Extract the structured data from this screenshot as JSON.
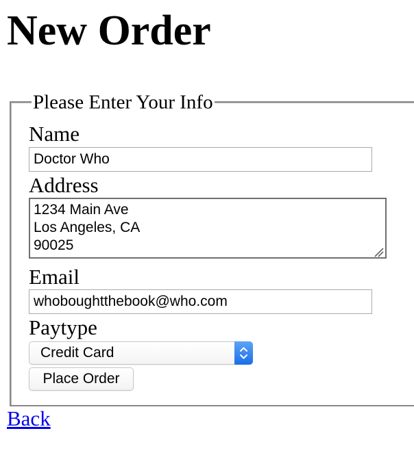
{
  "page": {
    "title": "New Order"
  },
  "form": {
    "legend": "Please Enter Your Info",
    "name": {
      "label": "Name",
      "value": "Doctor Who"
    },
    "address": {
      "label": "Address",
      "lines": [
        "1234 Main Ave",
        "Los Angeles, CA",
        "90025"
      ]
    },
    "email": {
      "label": "Email",
      "value": "whoboughtthebook@who.com"
    },
    "paytype": {
      "label": "Paytype",
      "selected": "Credit Card"
    },
    "submit_label": "Place Order"
  },
  "nav": {
    "back_label": "Back"
  },
  "icons": {
    "select_arrows": "chevron-up-down-icon",
    "resize": "resize-grip-icon"
  },
  "colors": {
    "link": "#0000ee",
    "select_accent": "#1a6fe8"
  }
}
